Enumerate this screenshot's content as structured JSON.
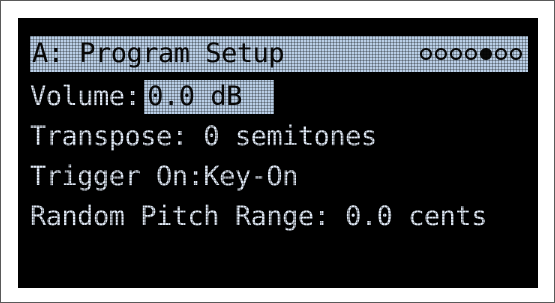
{
  "screen": {
    "title": "A: Program Setup",
    "page_indicator": {
      "total": 7,
      "active_index": 4
    },
    "params": [
      {
        "label": "Volume:",
        "value": "0.0 dB",
        "selected": true
      },
      {
        "label": "Transpose:",
        "value": "0 semitones",
        "selected": false
      },
      {
        "label": "Trigger On:",
        "value": "Key-On",
        "selected": false
      },
      {
        "label": "Random Pitch Range:",
        "value": "0.0 cents",
        "selected": false
      }
    ]
  },
  "colors": {
    "lcd_background": "#000000",
    "lcd_text": "#dfe8f4",
    "highlight": "#b9cee6"
  }
}
